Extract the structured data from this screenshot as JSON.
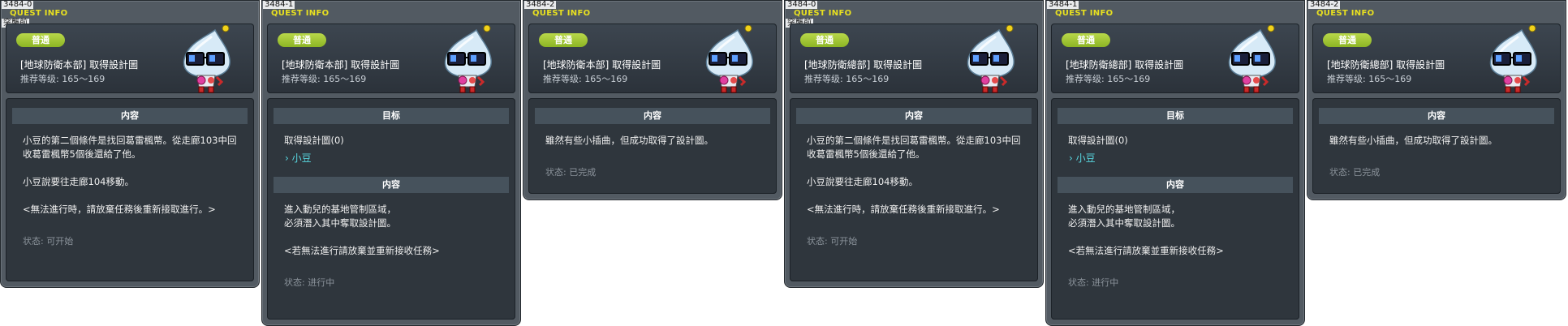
{
  "header_labels": {
    "quest_info": "QUEST INFO",
    "badge": "普通"
  },
  "panels": [
    {
      "id": "3484-0",
      "subtitle": "突襲前",
      "name": "[地球防衛本部] 取得設計圖",
      "level": "推荐等级: 165～169",
      "sections": [
        {
          "type": "head",
          "text": "内容"
        },
        {
          "type": "text",
          "text": "小豆的第二個條件是找回葛雷楓幣。從走廊103中回"
        },
        {
          "type": "text",
          "text": "收葛雷楓幣5個後還給了他。"
        },
        {
          "type": "text",
          "text": "小豆說要往走廊104移動。"
        },
        {
          "type": "text",
          "text": "<無法進行時，請放棄任務後重新接取進行。>"
        }
      ],
      "status": "状态: 可开始"
    },
    {
      "id": "3484-1",
      "subtitle": "",
      "name": "[地球防衛本部] 取得設計圖",
      "level": "推荐等级: 165～169",
      "sections": [
        {
          "type": "head",
          "text": "目标"
        },
        {
          "type": "text",
          "text": "取得設計圖(0)"
        },
        {
          "type": "npc",
          "text": "› 小豆"
        },
        {
          "type": "head",
          "text": "内容"
        },
        {
          "type": "text",
          "text": "進入動兒的基地管制區域，"
        },
        {
          "type": "text",
          "text": "必須潛入其中奪取設計圖。"
        },
        {
          "type": "text",
          "text": "<若無法進行請放棄並重新接收任務>"
        }
      ],
      "status": "状态: 进行中"
    },
    {
      "id": "3484-2",
      "subtitle": "",
      "name": "[地球防衛本部] 取得設計圖",
      "level": "推荐等级: 165～169",
      "sections": [
        {
          "type": "head",
          "text": "内容"
        },
        {
          "type": "text",
          "text": "雖然有些小插曲，但成功取得了設計圖。"
        }
      ],
      "status": "状态: 已完成"
    },
    {
      "id": "3484-0",
      "subtitle": "突襲前",
      "name": "[地球防衛總部] 取得設計圖",
      "level": "推荐等级: 165～169",
      "sections": [
        {
          "type": "head",
          "text": "内容"
        },
        {
          "type": "text",
          "text": "小豆的第二個條件是找回葛雷楓幣。從走廊103中回"
        },
        {
          "type": "text",
          "text": "收葛雷楓幣5個後還給了他。"
        },
        {
          "type": "text",
          "text": "小豆說要往走廊104移動。"
        },
        {
          "type": "text",
          "text": "<無法進行時，請放棄任務後重新接取進行。>"
        }
      ],
      "status": "状态: 可开始"
    },
    {
      "id": "3484-1",
      "subtitle": "",
      "name": "[地球防衛總部] 取得設計圖",
      "level": "推荐等级: 165～169",
      "sections": [
        {
          "type": "head",
          "text": "目标"
        },
        {
          "type": "text",
          "text": "取得設計圖(0)"
        },
        {
          "type": "npc",
          "text": "› 小豆"
        },
        {
          "type": "head",
          "text": "内容"
        },
        {
          "type": "text",
          "text": "進入動兒的基地管制區域，"
        },
        {
          "type": "text",
          "text": "必須潛入其中奪取設計圖。"
        },
        {
          "type": "text",
          "text": "<若無法進行請放棄並重新接收任務>"
        }
      ],
      "status": "状态: 进行中"
    },
    {
      "id": "3484-2",
      "subtitle": "",
      "name": "[地球防衛總部] 取得設計圖",
      "level": "推荐等级: 165～169",
      "sections": [
        {
          "type": "head",
          "text": "内容"
        },
        {
          "type": "text",
          "text": "雖然有些小插曲，但成功取得了設計圖。"
        }
      ],
      "status": "状态: 已完成"
    }
  ]
}
